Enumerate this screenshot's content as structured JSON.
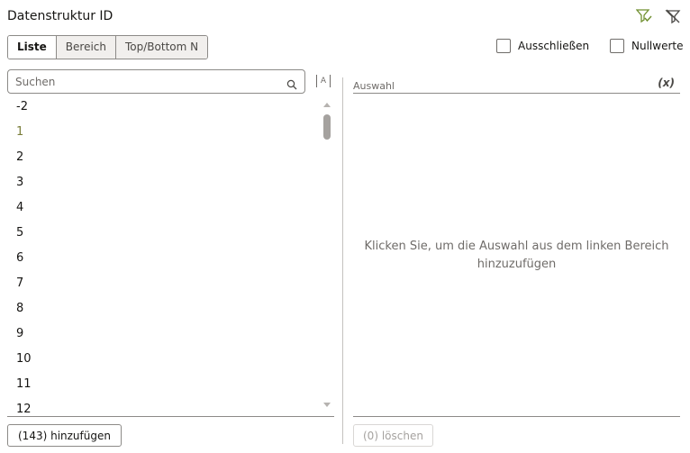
{
  "header": {
    "title": "Datenstruktur ID",
    "icons": [
      "filter-add-icon",
      "filter-clear-icon"
    ]
  },
  "modes": {
    "tabs": [
      {
        "label": "Liste",
        "active": true
      },
      {
        "label": "Bereich",
        "active": false
      },
      {
        "label": "Top/Bottom N",
        "active": false
      }
    ]
  },
  "options": {
    "exclude_label": "Ausschließen",
    "exclude_checked": false,
    "nulls_label": "Nullwerte",
    "nulls_checked": false
  },
  "search": {
    "placeholder": "Suchen",
    "value": ""
  },
  "case_toggle": {
    "glyph": "A"
  },
  "values": {
    "items": [
      "-2",
      "1",
      "2",
      "3",
      "4",
      "5",
      "6",
      "7",
      "8",
      "9",
      "10",
      "11",
      "12"
    ],
    "highlighted_index": 1,
    "add_label": "(143) hinzufügen"
  },
  "selection": {
    "header_label": "Auswahl",
    "fx_label": "(x)",
    "empty_line1": "Klicken Sie, um die Auswahl aus dem linken Bereich",
    "empty_line2": "hinzuzufügen",
    "clear_label": "(0) löschen"
  },
  "colors": {
    "accent_green": "#7a9a3a",
    "highlight_text": "#7a7d3a",
    "border": "#8c8a87"
  }
}
